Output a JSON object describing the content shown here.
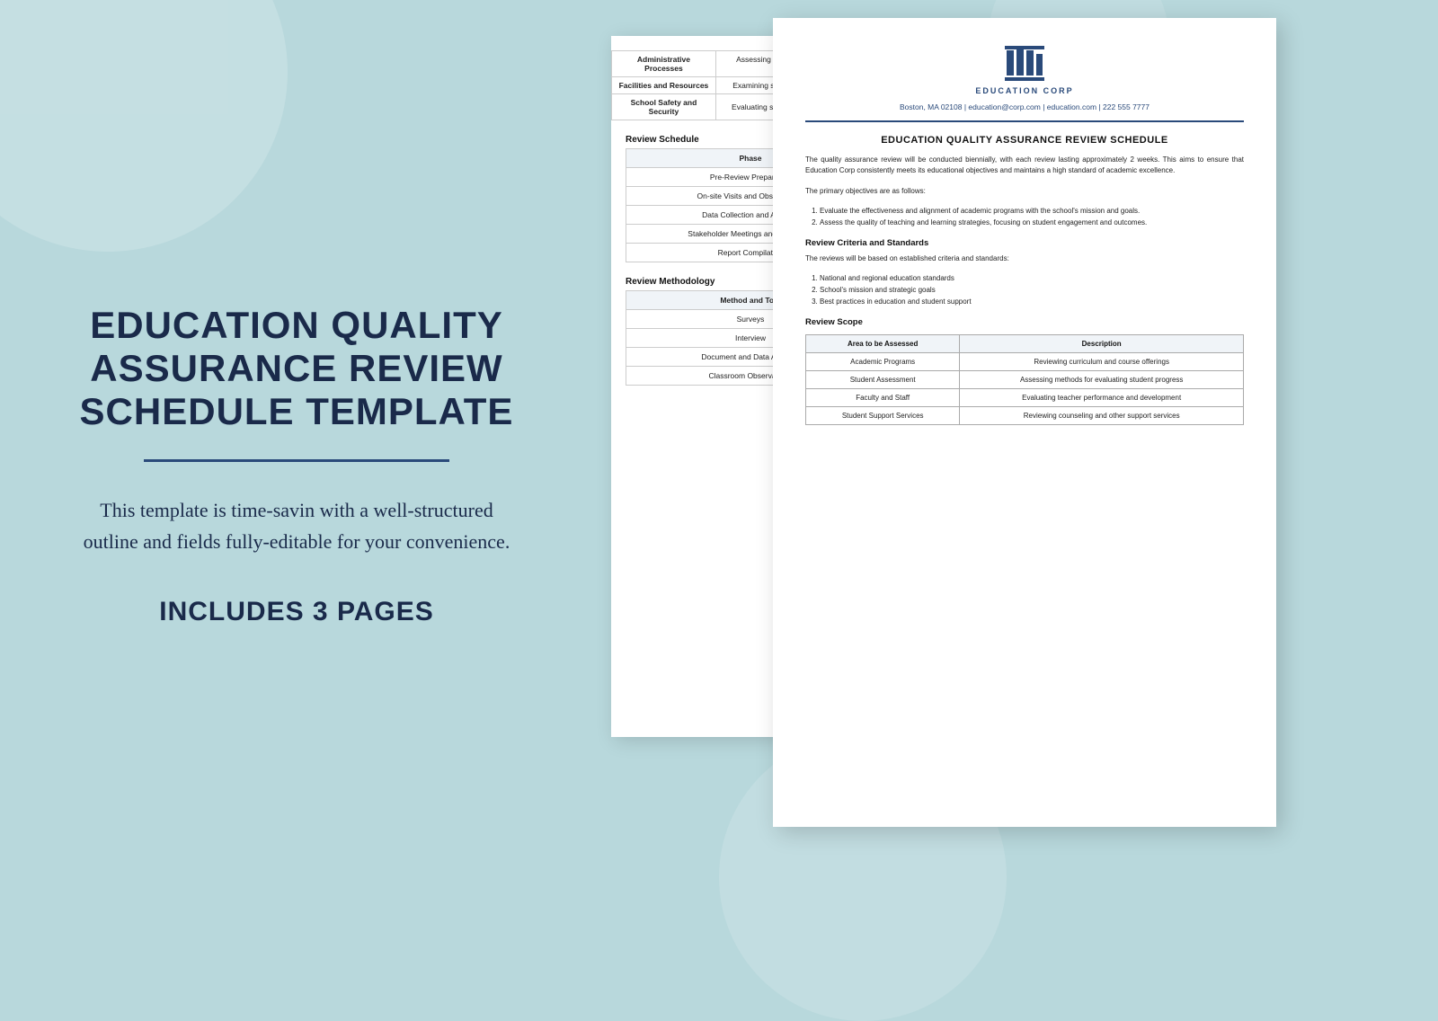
{
  "background": {
    "color": "#b8d8dc"
  },
  "left_panel": {
    "title": "EDUCATION QUALITY ASSURANCE REVIEW SCHEDULE TEMPLATE",
    "subtitle": "This template is time-savin with a well-structured outline and fields fully-editable for your convenience.",
    "includes_label": "INCLUDES 3 PAGES"
  },
  "back_page": {
    "top_table": {
      "rows": [
        [
          "Administrative Processes",
          "Assessing administrative efficiency and effectiveness"
        ],
        [
          "Facilities and Resources",
          "Examining school facilities and resources"
        ],
        [
          "School Safety and Security",
          "Evaluating safety measures and protocols"
        ]
      ]
    },
    "review_schedule_title": "Review Schedule",
    "phase_table": {
      "header": "Phase",
      "rows": [
        "Pre-Review Preparation",
        "On-site Visits and Observations",
        "Data Collection and Analysis",
        "Stakeholder Meetings and Interviews",
        "Report Compilation"
      ]
    },
    "review_methodology_title": "Review Methodology",
    "methodology_table": {
      "header": "Method and Tool",
      "rows": [
        "Surveys",
        "Interview",
        "Document and Data Analysis",
        "Classroom Observations"
      ]
    }
  },
  "front_page": {
    "logo": {
      "text": "EDUCATION CORP"
    },
    "contact": "Boston, MA 02108 | education@corp.com | education.com | 222 555 7777",
    "doc_title": "EDUCATION QUALITY ASSURANCE REVIEW SCHEDULE",
    "intro_paragraph": "The quality assurance review will be conducted biennially, with each review lasting approximately 2 weeks. This aims to ensure that Education Corp consistently meets its educational objectives and maintains a high standard of academic excellence.",
    "objectives_title": "The primary objectives are as follows:",
    "objectives_list": [
      "Evaluate the effectiveness and alignment of academic programs with the school's mission and goals.",
      "Assess the quality of teaching and learning strategies, focusing on student engagement and outcomes."
    ],
    "criteria_title": "Review Criteria and Standards",
    "criteria_intro": "The reviews will be based on established criteria and standards:",
    "criteria_list": [
      "National and regional education standards",
      "School's mission and strategic goals",
      "Best practices in education and student support"
    ],
    "scope_title": "Review Scope",
    "scope_table": {
      "headers": [
        "Area to be Assessed",
        "Description"
      ],
      "rows": [
        [
          "Academic Programs",
          "Reviewing curriculum and course offerings"
        ],
        [
          "Student Assessment",
          "Assessing methods for evaluating student progress"
        ],
        [
          "Faculty and Staff",
          "Evaluating teacher performance and development"
        ],
        [
          "Student Support Services",
          "Reviewing counseling and other support services"
        ]
      ]
    }
  }
}
